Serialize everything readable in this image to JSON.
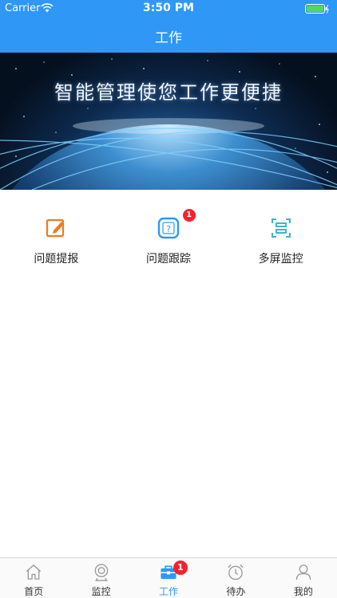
{
  "status_bar": {
    "carrier": "Carrier",
    "time": "3:50 PM"
  },
  "nav": {
    "title": "工作"
  },
  "banner": {
    "text": "智能管理使您工作更便捷"
  },
  "actions": [
    {
      "label": "问题提报",
      "icon": "edit-icon",
      "badge": ""
    },
    {
      "label": "问题跟踪",
      "icon": "question-icon",
      "badge": "1"
    },
    {
      "label": "多屏监控",
      "icon": "scan-icon",
      "badge": ""
    }
  ],
  "tabs": [
    {
      "label": "首页",
      "icon": "home-icon",
      "active": false,
      "badge": ""
    },
    {
      "label": "监控",
      "icon": "camera-icon",
      "active": false,
      "badge": ""
    },
    {
      "label": "工作",
      "icon": "briefcase-icon",
      "active": true,
      "badge": "1"
    },
    {
      "label": "待办",
      "icon": "alarm-clock-icon",
      "active": false,
      "badge": ""
    },
    {
      "label": "我的",
      "icon": "user-icon",
      "active": false,
      "badge": ""
    }
  ],
  "colors": {
    "primary": "#2f97f5",
    "accent_orange": "#f07a1e",
    "badge_red": "#f5222d",
    "scan_teal": "#3fb6c9"
  }
}
